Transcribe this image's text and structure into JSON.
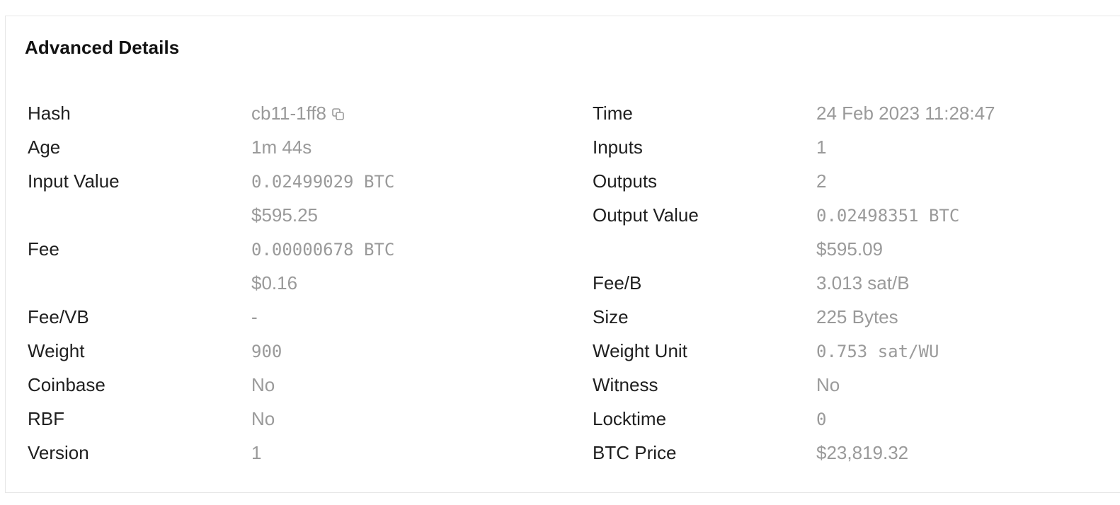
{
  "section": {
    "title": "Advanced Details"
  },
  "left": [
    {
      "label": "Hash",
      "values": [
        "cb11-1ff8"
      ],
      "copy": true
    },
    {
      "label": "Age",
      "values": [
        "1m 44s"
      ]
    },
    {
      "label": "Input Value",
      "values": [
        "0.02499029 BTC",
        "$595.25"
      ]
    },
    {
      "label": "Fee",
      "values": [
        "0.00000678 BTC",
        "$0.16"
      ]
    },
    {
      "label": "Fee/VB",
      "values": [
        "-"
      ]
    },
    {
      "label": "Weight",
      "values": [
        "900"
      ]
    },
    {
      "label": "Coinbase",
      "values": [
        "No"
      ]
    },
    {
      "label": "RBF",
      "values": [
        "No"
      ]
    },
    {
      "label": "Version",
      "values": [
        "1"
      ]
    }
  ],
  "right": [
    {
      "label": "Time",
      "values": [
        "24 Feb 2023 11:28:47"
      ]
    },
    {
      "label": "Inputs",
      "values": [
        "1"
      ]
    },
    {
      "label": "Outputs",
      "values": [
        "2"
      ]
    },
    {
      "label": "Output Value",
      "values": [
        "0.02498351 BTC",
        "$595.09"
      ]
    },
    {
      "label": "Fee/B",
      "values": [
        "3.013 sat/B"
      ]
    },
    {
      "label": "Size",
      "values": [
        "225 Bytes"
      ]
    },
    {
      "label": "Weight Unit",
      "values": [
        "0.753 sat/WU"
      ]
    },
    {
      "label": "Witness",
      "values": [
        "No"
      ]
    },
    {
      "label": "Locktime",
      "values": [
        "0"
      ]
    },
    {
      "label": "BTC Price",
      "values": [
        "$23,819.32"
      ]
    }
  ],
  "icons": {
    "copy": "copy-icon"
  },
  "colors": {
    "label": "#1f1f1f",
    "value": "#9a9a9a",
    "border": "#e6e6e6"
  }
}
